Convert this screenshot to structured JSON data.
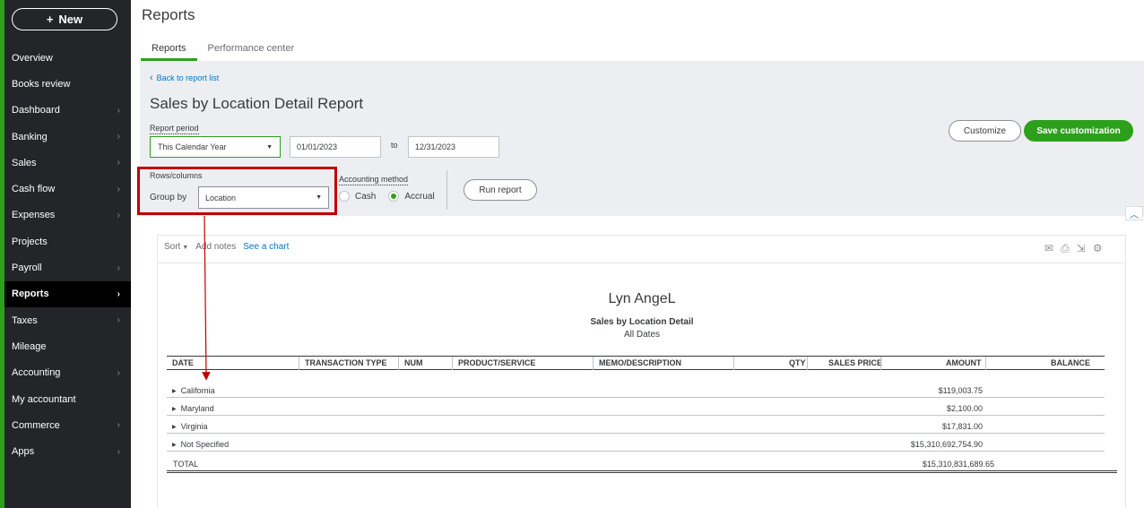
{
  "sidebar": {
    "new_label": "New",
    "items": [
      {
        "label": "Overview",
        "chevron": false
      },
      {
        "label": "Books review",
        "chevron": false
      },
      {
        "label": "Dashboard",
        "chevron": true
      },
      {
        "label": "Banking",
        "chevron": true
      },
      {
        "label": "Sales",
        "chevron": true
      },
      {
        "label": "Cash flow",
        "chevron": true
      },
      {
        "label": "Expenses",
        "chevron": true
      },
      {
        "label": "Projects",
        "chevron": false
      },
      {
        "label": "Payroll",
        "chevron": true
      },
      {
        "label": "Reports",
        "chevron": true,
        "active": true
      },
      {
        "label": "Taxes",
        "chevron": true
      },
      {
        "label": "Mileage",
        "chevron": false
      },
      {
        "label": "Accounting",
        "chevron": true
      },
      {
        "label": "My accountant",
        "chevron": false
      },
      {
        "label": "Commerce",
        "chevron": true
      },
      {
        "label": "Apps",
        "chevron": true
      }
    ]
  },
  "header": {
    "title": "Reports",
    "tabs": [
      {
        "label": "Reports",
        "active": true
      },
      {
        "label": "Performance center",
        "active": false
      }
    ]
  },
  "controls": {
    "back_link": "Back to report list",
    "report_title": "Sales by Location Detail Report",
    "period_label": "Report period",
    "period_value": "This Calendar Year",
    "date_from": "01/01/2023",
    "to_label": "to",
    "date_to": "12/31/2023",
    "rows_columns_label": "Rows/columns",
    "group_by_label": "Group by",
    "group_by_value": "Location",
    "accounting_method_label": "Accounting method",
    "cash_label": "Cash",
    "accrual_label": "Accrual",
    "selected_method": "Accrual",
    "run_report": "Run report",
    "customize": "Customize",
    "save_customization": "Save customization"
  },
  "toolbar": {
    "sort": "Sort",
    "add_notes": "Add notes",
    "see_chart": "See a chart"
  },
  "report": {
    "company": "Lyn AngeL",
    "name": "Sales by Location Detail",
    "dates": "All Dates",
    "columns": [
      "DATE",
      "TRANSACTION TYPE",
      "NUM",
      "PRODUCT/SERVICE",
      "MEMO/DESCRIPTION",
      "QTY",
      "SALES PRICE",
      "AMOUNT",
      "BALANCE"
    ],
    "rows": [
      {
        "location": "California",
        "amount": "$119,003.75"
      },
      {
        "location": "Maryland",
        "amount": "$2,100.00"
      },
      {
        "location": "Virginia",
        "amount": "$17,831.00"
      },
      {
        "location": "Not Specified",
        "amount": "$15,310,692,754.90"
      }
    ],
    "total_label": "TOTAL",
    "total_amount": "$15,310,831,689.65"
  },
  "colors": {
    "brand_green": "#2ca01c",
    "sidebar_bg": "#232529",
    "link_blue": "#0077c5",
    "highlight_red": "#c00000"
  }
}
